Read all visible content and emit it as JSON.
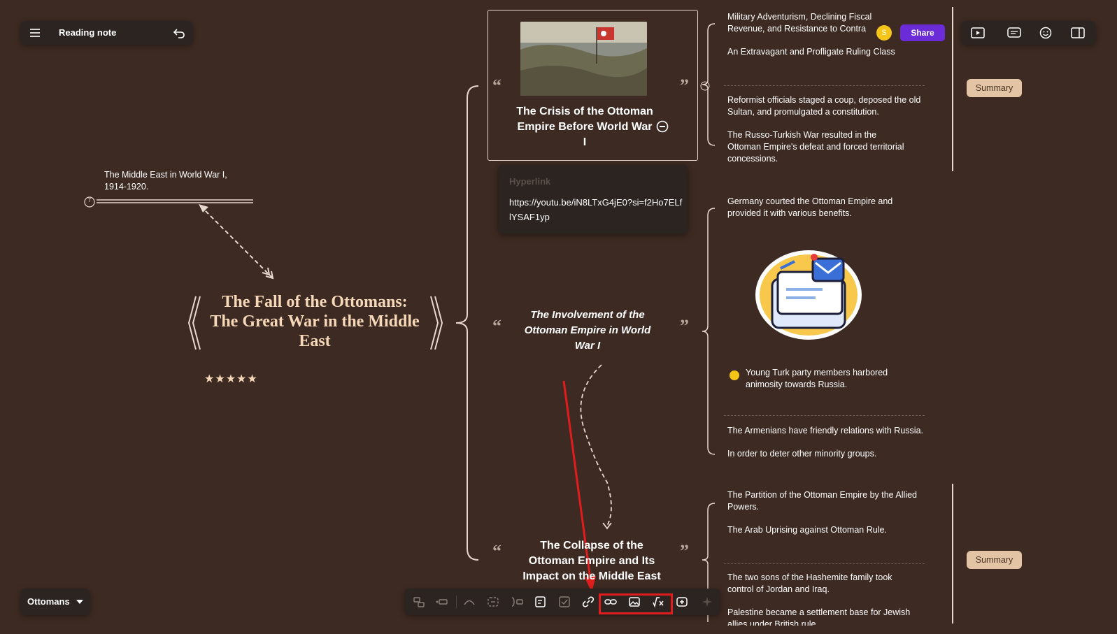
{
  "header": {
    "title": "Reading note",
    "avatar_initial": "S",
    "share_label": "Share"
  },
  "footer": {
    "map_name": "Ottomans"
  },
  "root": {
    "title": "The Fall of the Ottomans: The Great War in the Middle East",
    "rating": "★★★★★",
    "floating_note": "The Middle East in World War I, 1914-1920."
  },
  "topics": {
    "crisis": "The Crisis of the Ottoman Empire Before World War I",
    "involvement": "The Involvement of the Ottoman Empire in World War I",
    "collapse": "The Collapse of the Ottoman Empire and Its Impact on the Middle East"
  },
  "hyperlink": {
    "label": "Hyperlink",
    "url": "https://youtu.be/iN8LTxG4jE0?si=f2Ho7ELflYSAF1yp"
  },
  "subtopics": {
    "crisis": [
      "Military Adventurism, Declining Fiscal Revenue, and Resistance to Contra",
      "An Extravagant and Profligate Ruling Class",
      "Reformist officials staged a coup, deposed the old Sultan, and promulgated a constitution.",
      "The Russo-Turkish War resulted in the Ottoman Empire's defeat and forced territorial concessions."
    ],
    "involvement": [
      "Germany courted the Ottoman Empire and provided it with various benefits.",
      "Young Turk party members harbored animosity towards Russia.",
      "The Armenians have friendly relations with Russia.",
      "In order to deter other minority groups."
    ],
    "collapse": [
      "The Partition of the Ottoman Empire by the Allied Powers.",
      "The Arab Uprising against Ottoman Rule.",
      "The two sons of the Hashemite family took control of Jordan and Iraq.",
      "Palestine became a settlement base for Jewish allies under British rule."
    ]
  },
  "summary_label": "Summary",
  "floating_note_marker": "7",
  "colors": {
    "background": "#3d2a22",
    "panel": "#2b2421",
    "accent_share": "#6c2bd9",
    "highlight_red": "#e01c1c",
    "root_text": "#f7d8b8",
    "summary_bg": "#e3c4a4"
  }
}
